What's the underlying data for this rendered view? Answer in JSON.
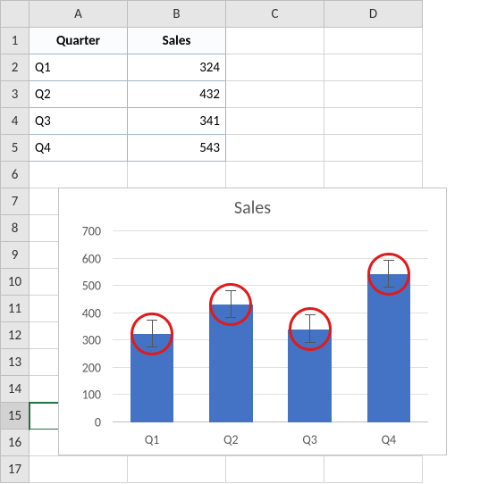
{
  "columns": [
    "A",
    "B",
    "C",
    "D"
  ],
  "rows": [
    "1",
    "2",
    "3",
    "4",
    "5",
    "6",
    "7",
    "8",
    "9",
    "10",
    "11",
    "12",
    "13",
    "14",
    "15",
    "16",
    "17"
  ],
  "selected_row": 15,
  "headers": {
    "quarter": "Quarter",
    "sales": "Sales"
  },
  "table": {
    "rows": [
      {
        "q": "Q1",
        "v": "324"
      },
      {
        "q": "Q2",
        "v": "432"
      },
      {
        "q": "Q3",
        "v": "341"
      },
      {
        "q": "Q4",
        "v": "543"
      }
    ]
  },
  "chart_title": "Sales",
  "chart_data": {
    "type": "bar",
    "categories": [
      "Q1",
      "Q2",
      "Q3",
      "Q4"
    ],
    "values": [
      324,
      432,
      341,
      543
    ],
    "error_amount": 50,
    "title": "Sales",
    "xlabel": "",
    "ylabel": "",
    "ylim": [
      0,
      700
    ],
    "yticks": [
      0,
      100,
      200,
      300,
      400,
      500,
      600,
      700
    ],
    "annotations": "red ovals highlighting error bars on each column"
  }
}
